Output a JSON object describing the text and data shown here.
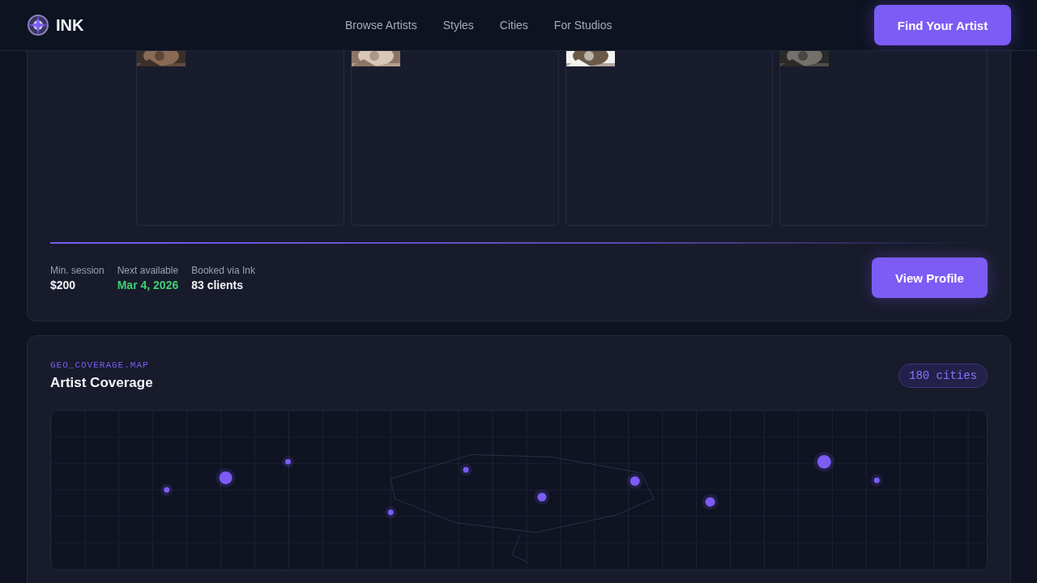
{
  "header": {
    "logo": "INK",
    "nav": [
      "Browse Artists",
      "Styles",
      "Cities",
      "For Studios"
    ],
    "cta": "Find Your Artist"
  },
  "artist_card": {
    "stats": [
      {
        "label": "Min. session",
        "value": "$200",
        "kind": "plain"
      },
      {
        "label": "Next available",
        "value": "Mar 4, 2026",
        "kind": "available"
      },
      {
        "label": "Booked via Ink",
        "value": "83 clients",
        "kind": "plain"
      }
    ],
    "button": "View Profile"
  },
  "coverage": {
    "code": "GEO_COVERAGE.MAP",
    "title": "Artist Coverage",
    "badge": "180 cities"
  }
}
